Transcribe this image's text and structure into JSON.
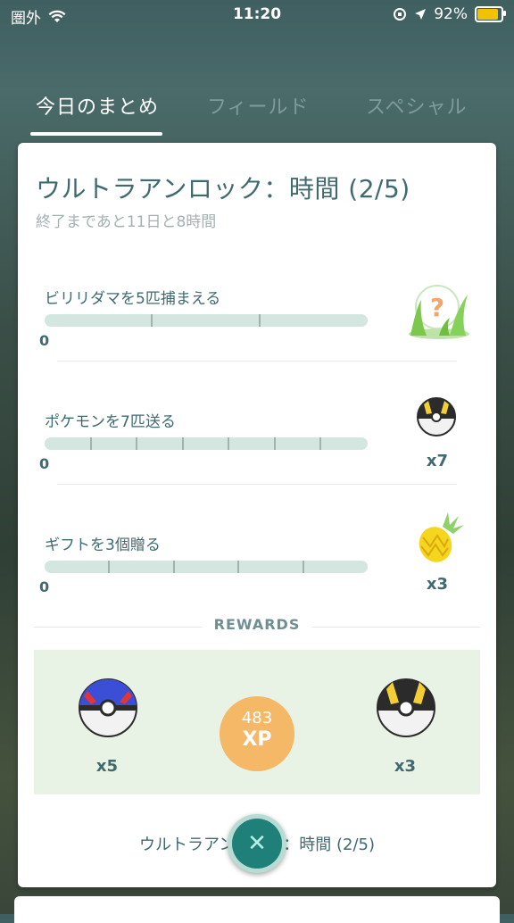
{
  "status_bar": {
    "carrier": "圏外",
    "time": "11:20",
    "battery": "92%",
    "battery_fraction": 0.92
  },
  "tabs": [
    {
      "label": "今日のまとめ",
      "active": true
    },
    {
      "label": "フィールド",
      "active": false
    },
    {
      "label": "スペシャル",
      "active": false
    }
  ],
  "card": {
    "title": "ウルトラアンロック：時間 (2/5)",
    "subtitle": "終了まであと11日と8時間"
  },
  "tasks": [
    {
      "label": "ビリリダマを5匹捕まえる",
      "count": "0",
      "progress": 0,
      "reward_icon": "mystery-encounter-icon",
      "reward_qty": ""
    },
    {
      "label": "ポケモンを7匹送る",
      "count": "0",
      "progress": 0,
      "reward_icon": "ultra-ball-icon",
      "reward_qty": "x7"
    },
    {
      "label": "ギフトを3個贈る",
      "count": "0",
      "progress": 0,
      "reward_icon": "golden-pinap-berry-icon",
      "reward_qty": "x3"
    }
  ],
  "rewards": {
    "header": "REWARDS",
    "items": [
      {
        "icon": "great-ball-icon",
        "qty": "x5"
      },
      {
        "icon": "xp-icon",
        "value": "483",
        "unit": "XP"
      },
      {
        "icon": "ultra-ball-icon",
        "qty": "x3"
      }
    ]
  },
  "footer": {
    "text": "ウルトラアンロック：時間 (2/5)",
    "close_icon": "close-icon"
  },
  "colors": {
    "accent": "#3f6a6f",
    "xp_badge": "#f4b866",
    "close_button": "#1f8079"
  }
}
